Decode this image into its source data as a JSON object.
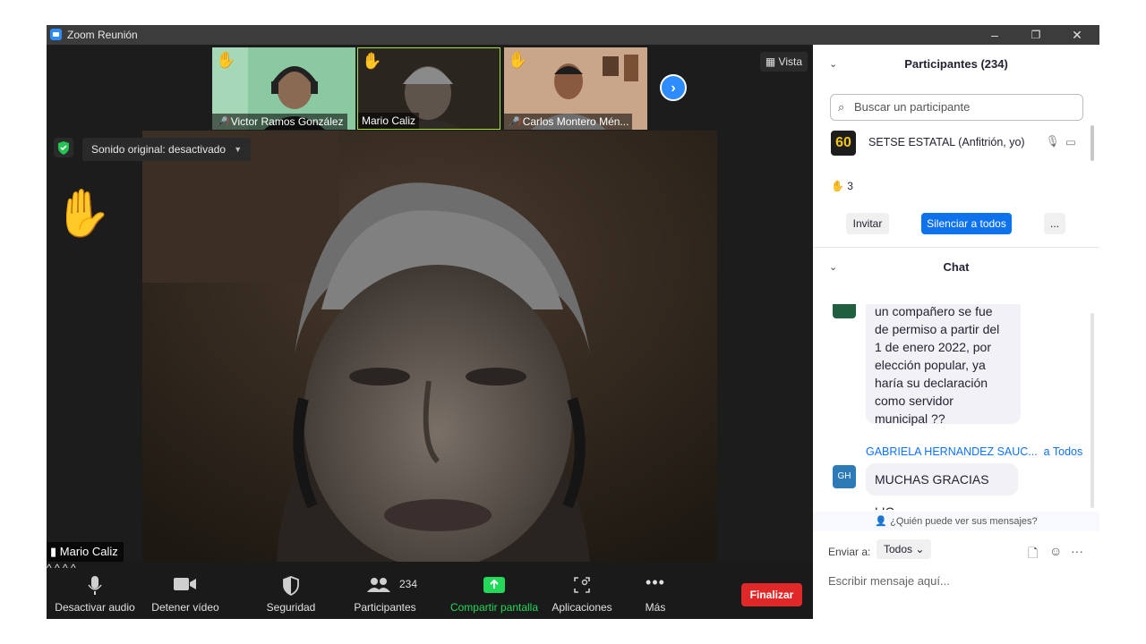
{
  "window": {
    "title": "Zoom Reunión",
    "min": "–",
    "restore": "❐",
    "close": "✕"
  },
  "thumbs": [
    {
      "name": "Victor Ramos González",
      "muted": true
    },
    {
      "name": "Mario Caliz",
      "muted": false
    },
    {
      "name": "Carlos Montero  Mén...",
      "muted": true
    }
  ],
  "view_label": "Vista",
  "sound_label": "Sonido original: desactivado",
  "speaker_name": "Mario Caliz",
  "toolbar": {
    "audio": "Desactivar audio",
    "video": "Detener vídeo",
    "security": "Seguridad",
    "participants": "Participantes",
    "participants_count": "234",
    "share": "Compartir pantalla",
    "apps": "Aplicaciones",
    "more": "Más",
    "end": "Finalizar"
  },
  "participants_panel": {
    "title": "Participantes (234)",
    "search_placeholder": "Buscar un participante",
    "host_avatar": "60",
    "host_name": "SETSE ESTATAL (Anfitrión, yo)",
    "raised_hands": "3",
    "invite": "Invitar",
    "mute_all": "Silenciar a todos",
    "more": "..."
  },
  "chat": {
    "title": "Chat",
    "msg1_lines": [
      "un compañero se fue",
      "de permiso a partir del",
      "1 de enero 2022, por",
      "elección popular, ya",
      "haría su declaración",
      "como servidor",
      "municipal ??"
    ],
    "sender": "GABRIELA HERNANDEZ SAUC...",
    "to": "a Todos",
    "sender_initials": "GH",
    "msg2": "MUCHAS GRACIAS LIC",
    "who_can_see": "¿Quién puede ver sus mensajes?",
    "send_to_label": "Enviar a:",
    "send_to_value": "Todos",
    "input_placeholder": "Escribir mensaje aquí..."
  },
  "colors": {
    "accent": "#0e72ed",
    "end": "#e02828",
    "share": "#23d959",
    "avatar_gh": "#2c7bb6",
    "avatar_top": "#1f5f3f"
  }
}
